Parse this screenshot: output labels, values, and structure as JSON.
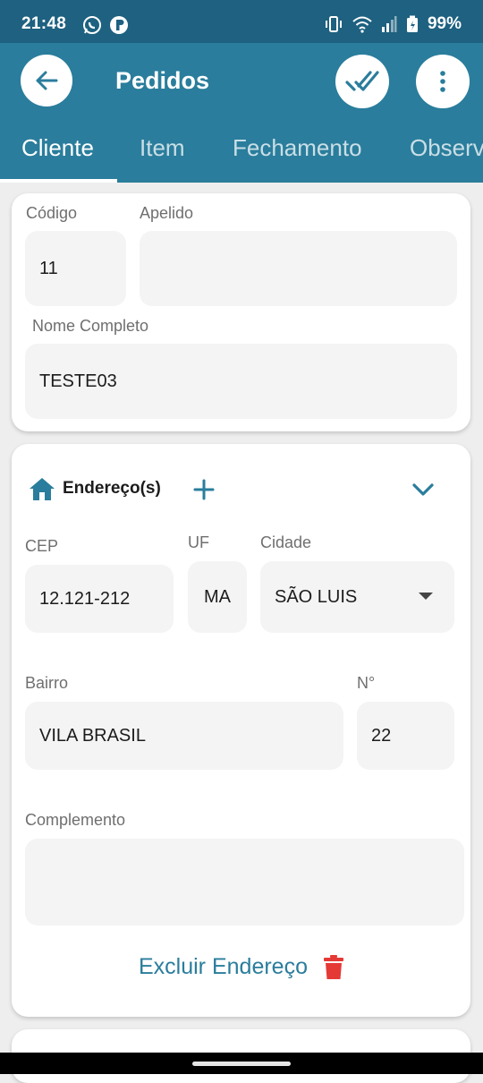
{
  "status_bar": {
    "time": "21:48",
    "battery": "99%"
  },
  "app_bar": {
    "title": "Pedidos",
    "tabs": [
      {
        "label": "Cliente",
        "active": true
      },
      {
        "label": "Item",
        "active": false
      },
      {
        "label": "Fechamento",
        "active": false
      },
      {
        "label": "Observ",
        "active": false
      }
    ]
  },
  "client": {
    "codigo_label": "Código",
    "codigo_value": "11",
    "apelido_label": "Apelido",
    "apelido_value": "",
    "nome_label": "Nome Completo",
    "nome_value": "TESTE03"
  },
  "address": {
    "title": "Endereço(s)",
    "cep_label": "CEP",
    "cep_value": "12.121-212",
    "uf_label": "UF",
    "uf_value": "MA",
    "cidade_label": "Cidade",
    "cidade_value": "SÃO LUIS",
    "bairro_label": "Bairro",
    "bairro_value": "VILA BRASIL",
    "numero_label": "N°",
    "numero_value": "22",
    "complemento_label": "Complemento",
    "complemento_value": "",
    "delete_label": "Excluir Endereço"
  },
  "colors": {
    "status_bar": "#1e6180",
    "app_bar": "#2a7d9c",
    "accent": "#2a7d9c",
    "delete": "#e53935"
  },
  "icons": {
    "back": "arrow-left-icon",
    "confirm": "double-check-icon",
    "more": "more-vert-icon",
    "home": "home-icon",
    "add": "plus-icon",
    "collapse": "chevron-down-icon",
    "delete": "trash-icon"
  }
}
